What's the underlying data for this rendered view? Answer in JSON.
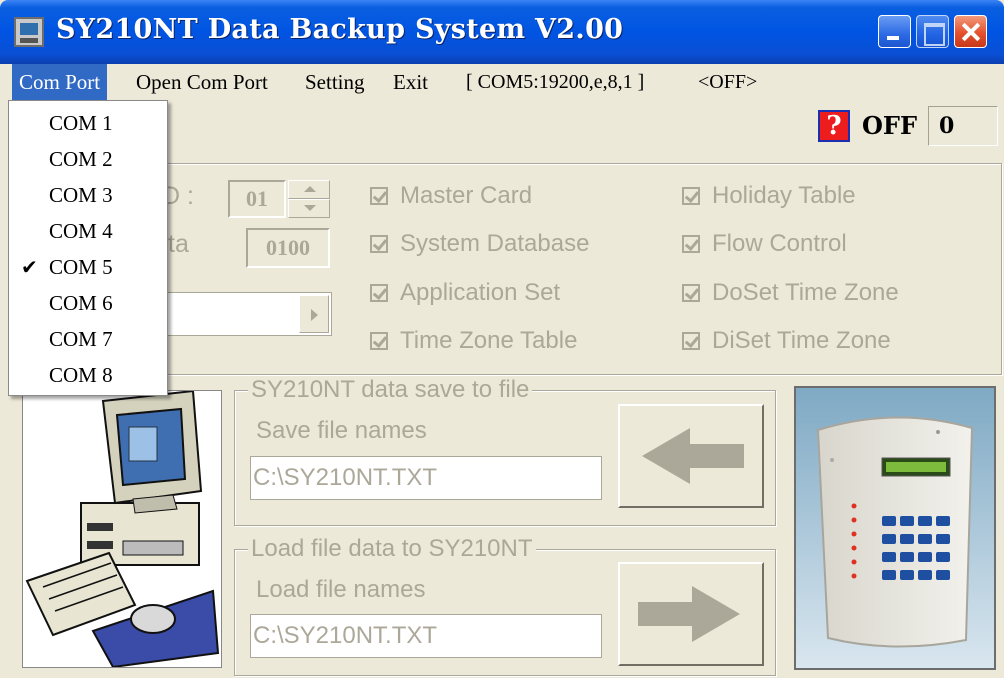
{
  "window": {
    "title": "SY210NT Data Backup System V2.00"
  },
  "menu": {
    "com_port": "Com Port",
    "open_com_port": "Open Com Port",
    "setting": "Setting",
    "exit": "Exit",
    "port_status": "[ COM5:19200,e,8,1 ]",
    "port_state": "<OFF>"
  },
  "status": {
    "help_glyph": "?",
    "state": "OFF",
    "counter": "0"
  },
  "com_port_menu": {
    "selected": "COM 5",
    "items": [
      "COM 1",
      "COM 2",
      "COM 3",
      "COM 4",
      "COM 5",
      "COM 6",
      "COM 7",
      "COM 8"
    ],
    "check_glyph": "✔"
  },
  "options": {
    "id_label_fragment": "D :",
    "id_value": "01",
    "data_label_fragment": "ta",
    "data_value": "0100",
    "checkboxes": [
      {
        "label": "Master Card",
        "checked": true
      },
      {
        "label": "System Database",
        "checked": true
      },
      {
        "label": "Application Set",
        "checked": true
      },
      {
        "label": "Time Zone Table",
        "checked": true
      },
      {
        "label": "Holiday Table",
        "checked": true
      },
      {
        "label": "Flow Control",
        "checked": true
      },
      {
        "label": "DoSet Time Zone",
        "checked": true
      },
      {
        "label": "DiSet Time Zone",
        "checked": true
      }
    ]
  },
  "save_group": {
    "title": "SY210NT data save to file",
    "label": "Save file names",
    "value": "C:\\SY210NT.TXT"
  },
  "load_group": {
    "title": "Load file data to SY210NT",
    "label": "Load file names",
    "value": "C:\\SY210NT.TXT"
  },
  "colors": {
    "titlebar": "#0054e3",
    "menu_highlight": "#316ac5",
    "disabled_text": "#aca899",
    "face": "#ece9d8"
  }
}
